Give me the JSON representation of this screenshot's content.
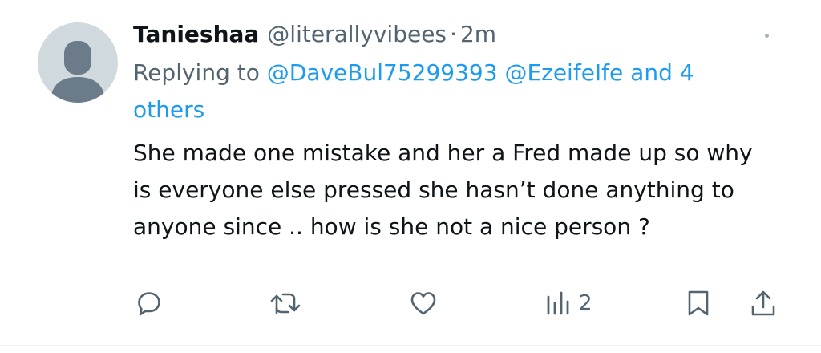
{
  "tweet": {
    "author": {
      "display_name": "Tanieshaa",
      "handle": "@literallyvibees",
      "avatar_icon": "default-profile-icon"
    },
    "separator": "·",
    "time": "2m",
    "replying": {
      "prefix": "Replying to",
      "mentions": [
        "@DaveBul75299393",
        "@EzeifeIfe"
      ],
      "and": "and",
      "others_count": "4",
      "others_label": "others"
    },
    "text": "She made one mistake and her a Fred made up so why is everyone else pressed she hasn’t done anything to anyone since .. how is she not a nice person ?",
    "more_icon": "more-horizontal-icon",
    "actions": {
      "reply_icon": "reply-icon",
      "retweet_icon": "retweet-icon",
      "like_icon": "heart-icon",
      "views_icon": "views-chart-icon",
      "views_count": "2",
      "bookmark_icon": "bookmark-icon",
      "share_icon": "share-icon"
    },
    "colors": {
      "link": "#1d9bf0",
      "secondary_text": "#536471",
      "primary_text": "#0f1419",
      "avatar_bg": "#cfd9de",
      "avatar_fg": "#6b7b89"
    }
  }
}
